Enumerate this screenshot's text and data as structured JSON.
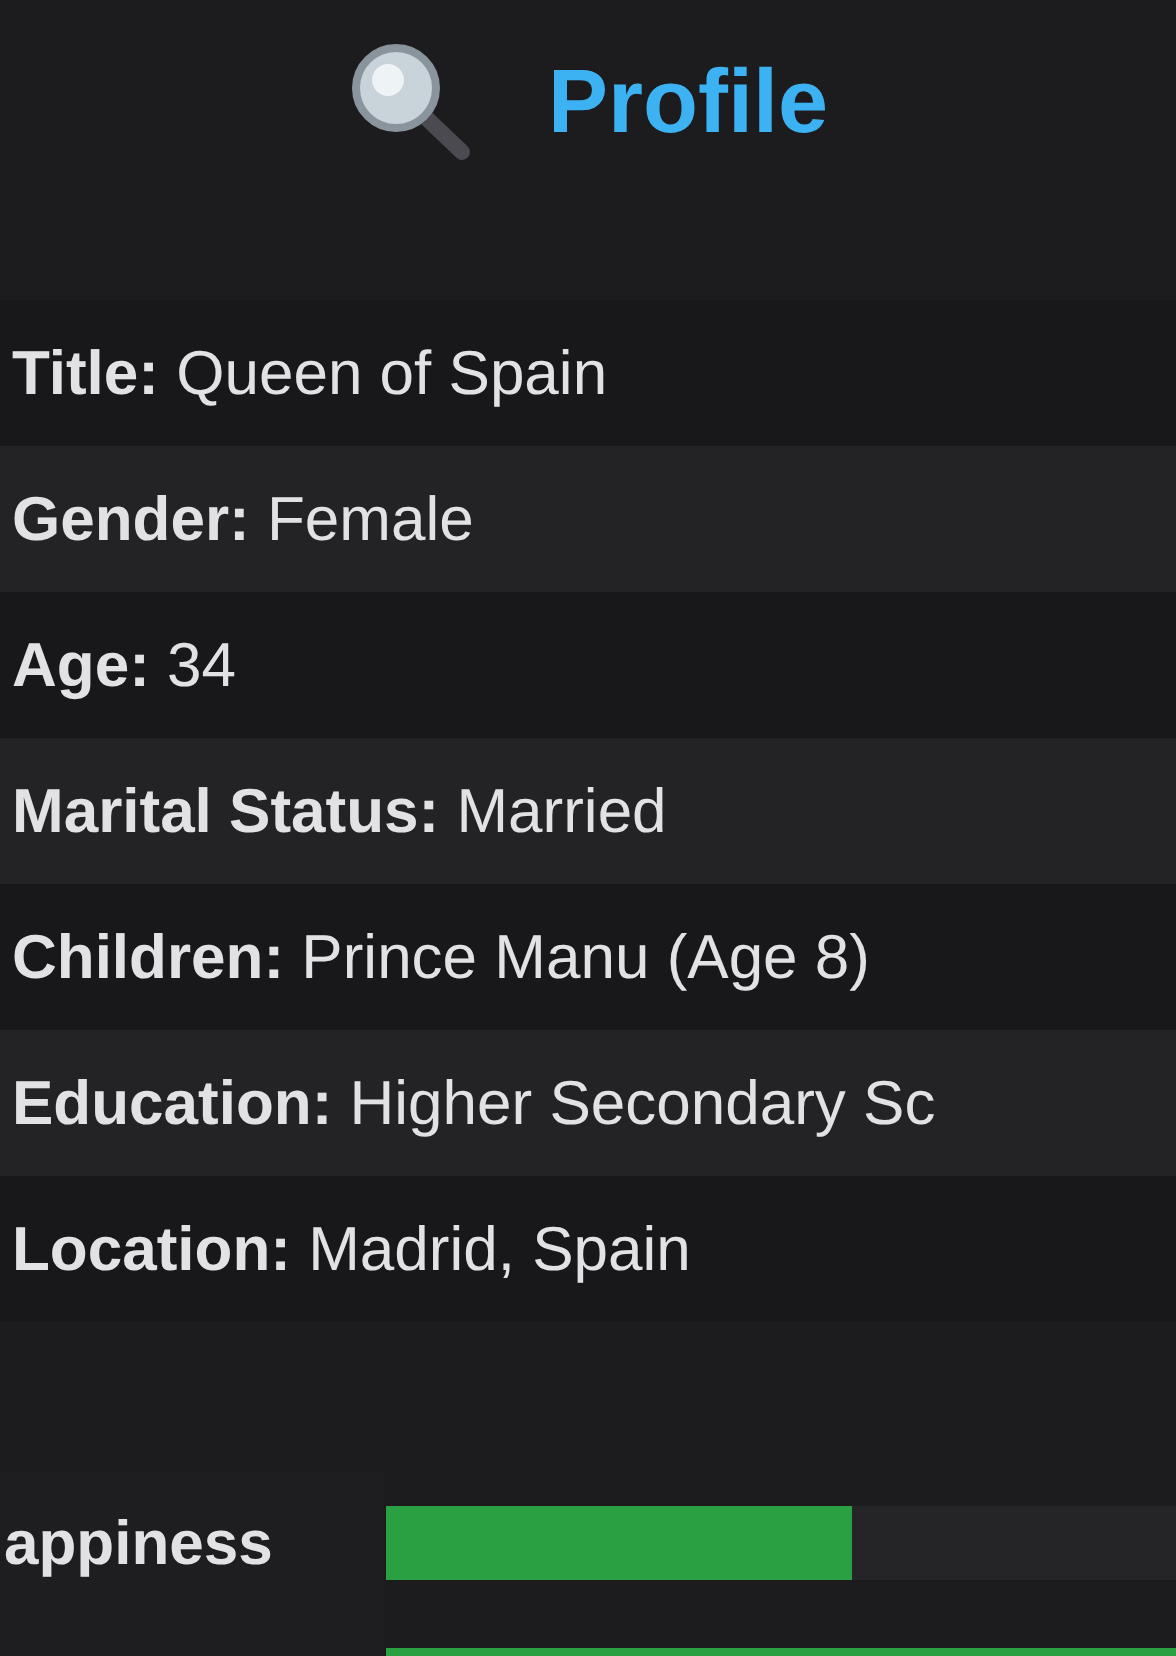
{
  "header": {
    "title": "Profile"
  },
  "fields": [
    {
      "label": "Title:",
      "value": "Queen of Spain"
    },
    {
      "label": "Gender:",
      "value": "Female"
    },
    {
      "label": "Age:",
      "value": "34"
    },
    {
      "label": "Marital Status:",
      "value": "Married"
    },
    {
      "label": "Children:",
      "value": "Prince Manu (Age 8)"
    },
    {
      "label": "Education:",
      "value": "Higher Secondary Sc"
    },
    {
      "label": "Location:",
      "value": "Madrid, Spain"
    }
  ],
  "stats": [
    {
      "label": "appiness",
      "level": 0.59
    },
    {
      "level": 1
    }
  ]
}
